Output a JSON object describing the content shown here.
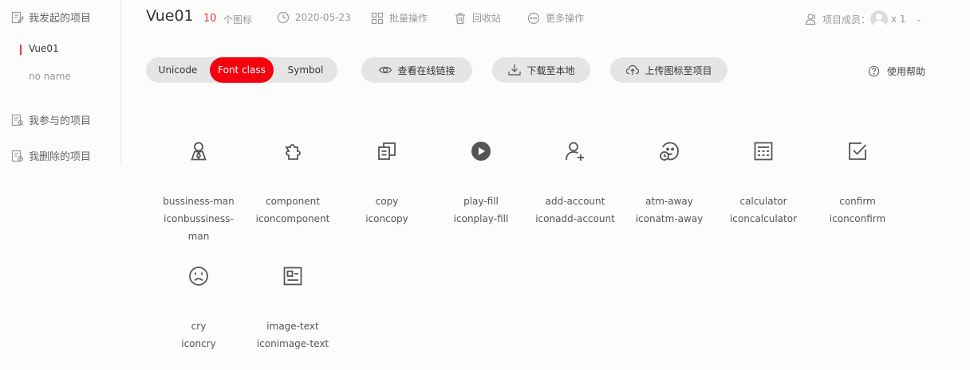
{
  "sidebar": {
    "my_projects": "我发起的项目",
    "projects": [
      "Vue01",
      "no name"
    ],
    "joined": "我参与的项目",
    "deleted": "我删除的项目"
  },
  "header": {
    "title": "Vue01",
    "icon_count": "10",
    "icon_count_label": "个图标",
    "date": "2020-05-23",
    "batch": "批量操作",
    "recycle": "回收站",
    "more": "更多操作",
    "members_label": "项目成员：",
    "members_count": "x 1"
  },
  "toolbar": {
    "tabs": [
      "Unicode",
      "Font class",
      "Symbol"
    ],
    "active_tab": "Font class",
    "view_link": "查看在线链接",
    "download": "下载至本地",
    "upload": "上传图标至项目",
    "help": "使用帮助"
  },
  "icons": [
    {
      "name": "bussiness-man",
      "class": "iconbussiness-man",
      "icon": "bussiness-man-icon"
    },
    {
      "name": "component",
      "class": "iconcomponent",
      "icon": "component-icon"
    },
    {
      "name": "copy",
      "class": "iconcopy",
      "icon": "copy-icon"
    },
    {
      "name": "play-fill",
      "class": "iconplay-fill",
      "icon": "play-fill-icon"
    },
    {
      "name": "add-account",
      "class": "iconadd-account",
      "icon": "add-account-icon"
    },
    {
      "name": "atm-away",
      "class": "iconatm-away",
      "icon": "atm-away-icon"
    },
    {
      "name": "calculator",
      "class": "iconcalculator",
      "icon": "calculator-icon"
    },
    {
      "name": "confirm",
      "class": "iconconfirm",
      "icon": "confirm-icon"
    },
    {
      "name": "cry",
      "class": "iconcry",
      "icon": "cry-icon"
    },
    {
      "name": "image-text",
      "class": "iconimage-text",
      "icon": "image-text-icon"
    }
  ],
  "colors": {
    "accent": "#f4000f",
    "count": "#e4393c",
    "pill": "#e5e5e5"
  }
}
